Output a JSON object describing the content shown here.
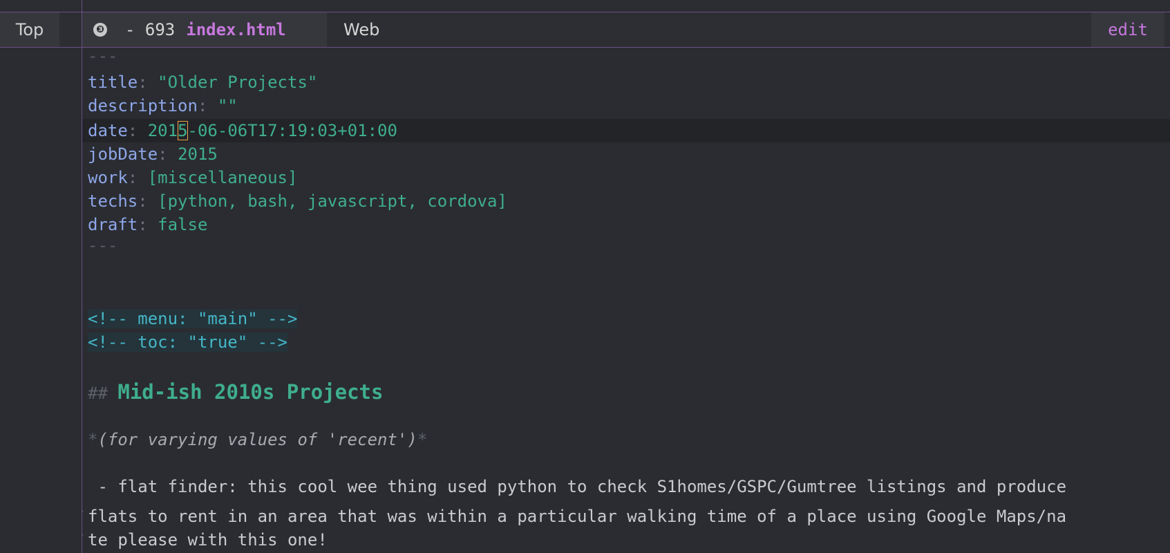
{
  "modeline": {
    "position": "Top",
    "window_number": "❸",
    "line_count": "- 693",
    "filename": "index.html",
    "mode_name": "Web",
    "evil_state": "edit"
  },
  "editor": {
    "frontmatter_delimiter": "---",
    "frontmatter": [
      {
        "key": "title",
        "sep": ": ",
        "value": "\"Older Projects\""
      },
      {
        "key": "description",
        "sep": ": ",
        "value": "\"\""
      },
      {
        "key": "date",
        "sep": ": ",
        "value_before_cursor": "201",
        "cursor_char": "5",
        "value_after_cursor": "-06-06T17:19:03+01:00"
      },
      {
        "key": "jobDate",
        "sep": ": ",
        "value": "2015"
      },
      {
        "key": "work",
        "sep": ": ",
        "value": "[miscellaneous]"
      },
      {
        "key": "techs",
        "sep": ": ",
        "value": "[python, bash, javascript, cordova]"
      },
      {
        "key": "draft",
        "sep": ": ",
        "value": "false"
      }
    ],
    "comments": [
      "<!-- menu: \"main\" -->",
      "<!-- toc: \"true\" -->"
    ],
    "heading": {
      "marker": "## ",
      "text": "Mid-ish 2010s Projects"
    },
    "italic_line": {
      "marker": "*",
      "text": "(for varying values of 'recent')"
    },
    "list_lines": [
      " - flat finder: this cool wee thing used python to check S1homes/GSPC/Gumtree listings and produce",
      "flats to rent in an area that was within a particular walking time of a place using Google Maps/na",
      "te please with this one!"
    ],
    "wrap_marker": "↳"
  }
}
